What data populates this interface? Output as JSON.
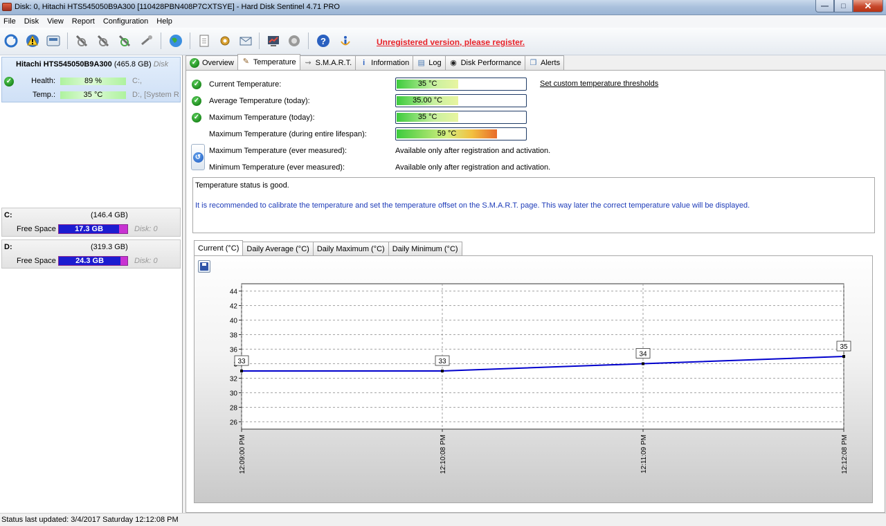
{
  "window": {
    "title": "Disk: 0, Hitachi HTS545050B9A300 [110428PBN408P7CXTSYE]  -  Hard Disk Sentinel 4.71 PRO",
    "buttons": [
      "—",
      "□",
      "✕"
    ]
  },
  "menu": [
    "File",
    "Disk",
    "View",
    "Report",
    "Configuration",
    "Help"
  ],
  "toolbar": {
    "register_text": "Unregistered version, please register.",
    "icons": [
      "refresh-icon",
      "alert-icon",
      "disk-icon",
      "test-icon",
      "test-icon",
      "test-icon",
      "test-icon",
      "globe-icon",
      "report-icon",
      "settings-icon",
      "mail-icon",
      "chart-icon",
      "sound-icon",
      "help-icon",
      "info-icon"
    ]
  },
  "left": {
    "disk": {
      "name": "Hitachi HTS545050B9A300",
      "size": "(465.8 GB)",
      "disk_tag": "Disk",
      "health_label": "Health:",
      "health_value": "89 %",
      "health_drive": "C:,",
      "temp_label": "Temp.:",
      "temp_value": "35 °C",
      "temp_drive": "D:,  [System R"
    },
    "volumes": [
      {
        "letter": "C:",
        "total": "(146.4 GB)",
        "free_label": "Free Space",
        "free": "17.3 GB",
        "free_ratio": 0.88,
        "disk": "Disk: 0"
      },
      {
        "letter": "D:",
        "total": "(319.3 GB)",
        "free_label": "Free Space",
        "free": "24.3 GB",
        "free_ratio": 0.9,
        "disk": "Disk: 0"
      }
    ]
  },
  "tabs": [
    "Overview",
    "Temperature",
    "S.M.A.R.T.",
    "Information",
    "Log",
    "Disk Performance",
    "Alerts"
  ],
  "temperature": {
    "threshold_link": "Set custom temperature thresholds",
    "rows": [
      {
        "label": "Current Temperature:",
        "value": "35 °C",
        "fill": 0.48
      },
      {
        "label": "Average Temperature (today):",
        "value": "35.00 °C",
        "fill": 0.48
      },
      {
        "label": "Maximum Temperature (today):",
        "value": "35 °C",
        "fill": 0.48
      },
      {
        "label": "Maximum Temperature (during entire lifespan):",
        "value": "59 °C",
        "fill": 0.78
      },
      {
        "label": "Maximum Temperature (ever measured):",
        "value": "Available only after registration and activation."
      },
      {
        "label": "Minimum Temperature (ever measured):",
        "value": "Available only after registration and activation."
      }
    ],
    "status_good": "Temperature status is good.",
    "status_note": "It is recommended to calibrate the temperature and set the temperature offset on the S.M.A.R.T. page. This way later the correct temperature value will be displayed."
  },
  "chart_tabs": [
    "Current (°C)",
    "Daily Average (°C)",
    "Daily Maximum (°C)",
    "Daily Minimum (°C)"
  ],
  "chart_data": {
    "type": "line",
    "x": [
      "12:09:00 PM",
      "12:10:08 PM",
      "12:11:09 PM",
      "12:12:08 PM"
    ],
    "series": [
      {
        "values": [
          33,
          33,
          34,
          35
        ]
      }
    ],
    "ylim": [
      25,
      45
    ],
    "yticks": [
      26,
      28,
      30,
      32,
      34,
      36,
      38,
      40,
      42,
      44
    ],
    "ytick_labels": [
      "26",
      "28",
      "30",
      "32",
      "3",
      "36",
      "38",
      "40",
      "42",
      "44"
    ],
    "grid": true,
    "line_color": "#0000cc"
  },
  "statusbar": {
    "text": "Status last updated: 3/4/2017 Saturday 12:12:08 PM"
  }
}
